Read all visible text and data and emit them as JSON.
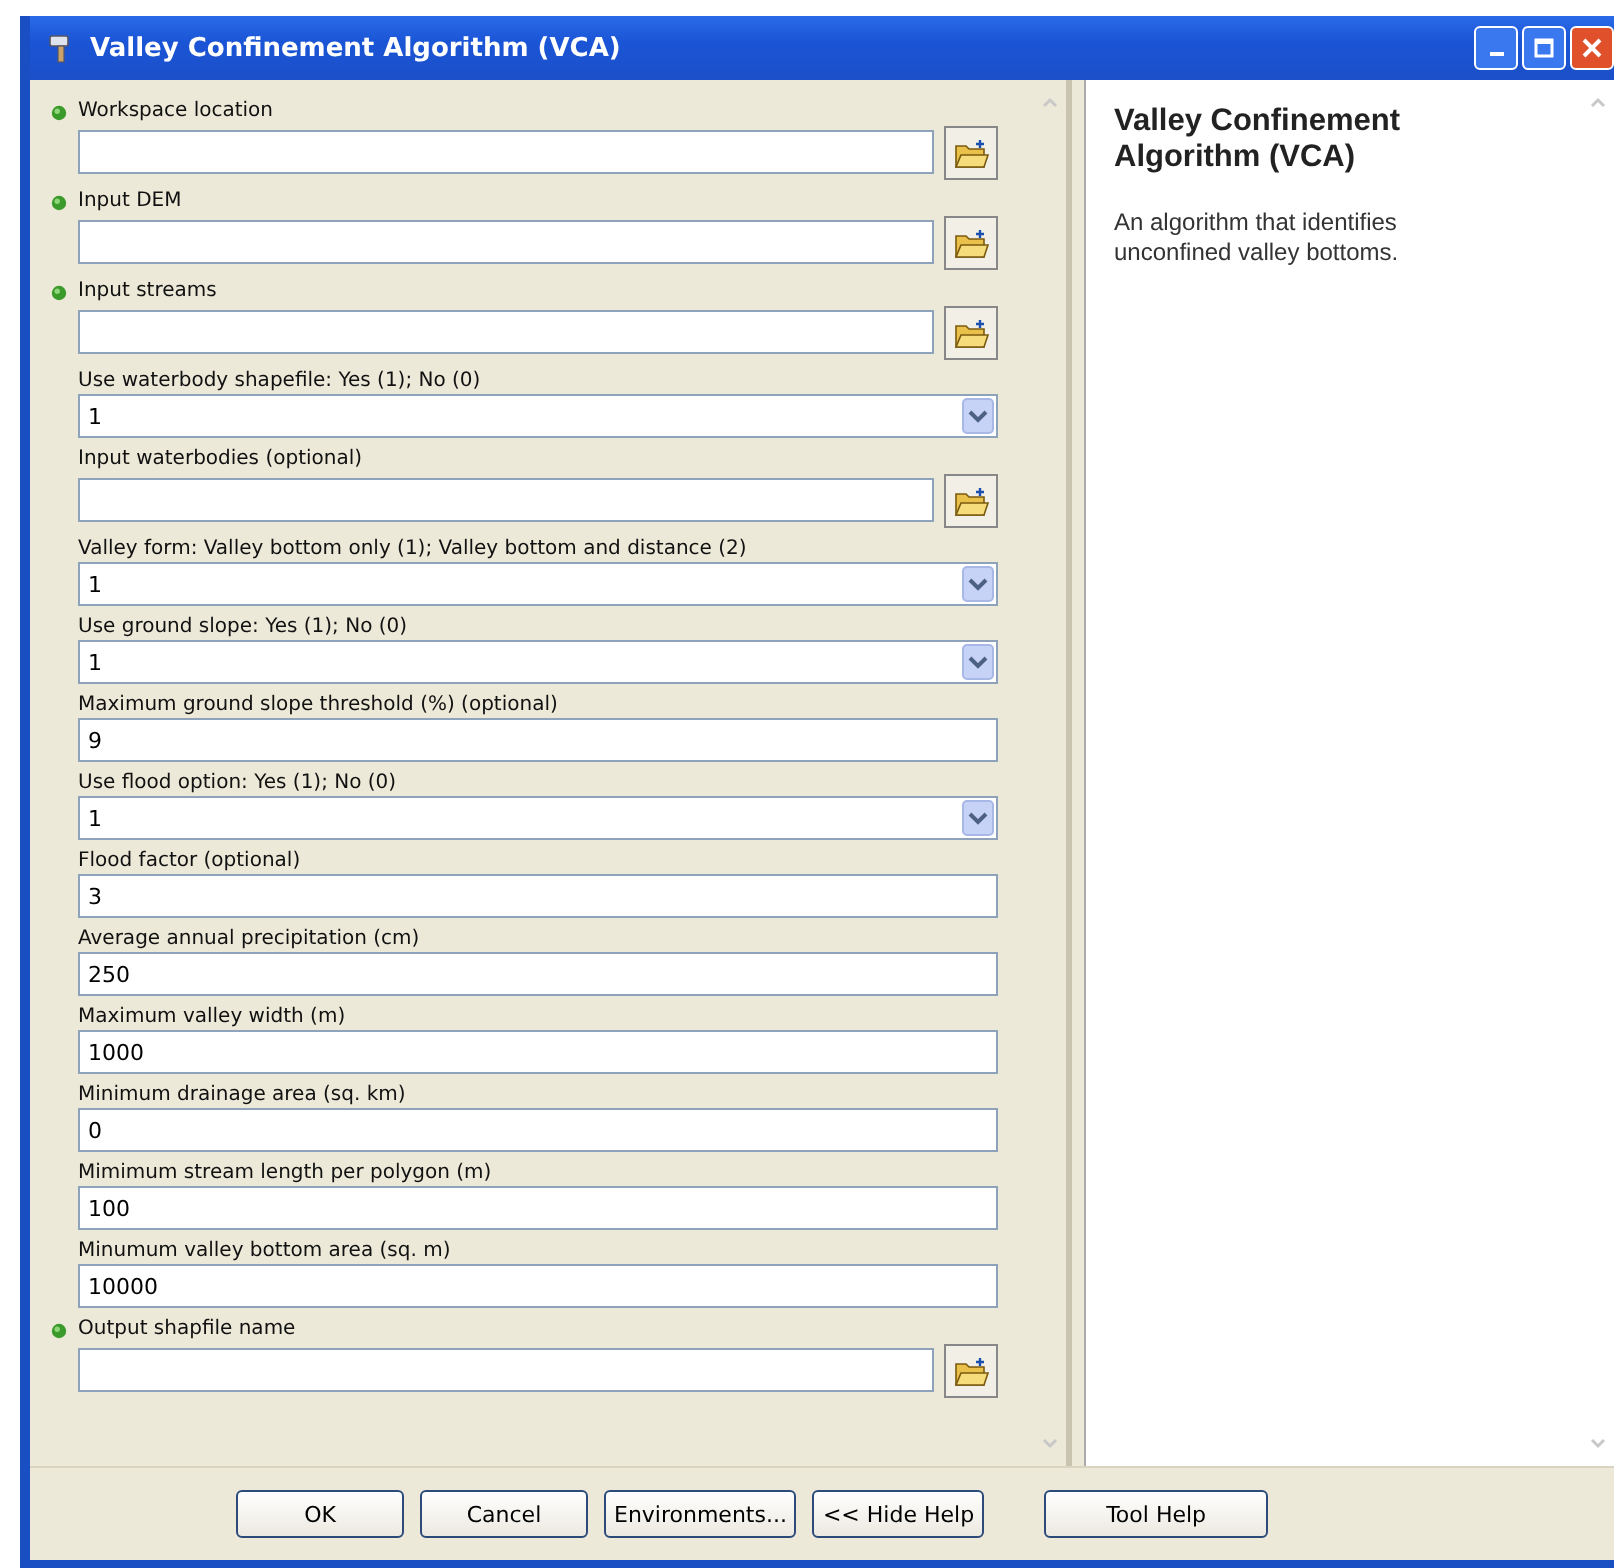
{
  "window": {
    "title": "Valley Confinement Algorithm (VCA)"
  },
  "parameters": [
    {
      "label": "Workspace location",
      "kind": "file",
      "required": true
    },
    {
      "label": "Input DEM",
      "kind": "file",
      "required": true
    },
    {
      "label": "Input streams",
      "kind": "file",
      "required": true
    },
    {
      "label": "Use waterbody shapefile: Yes (1); No (0)",
      "kind": "dropdown",
      "required": false,
      "value": "1"
    },
    {
      "label": "Input waterbodies (optional)",
      "kind": "file",
      "required": false
    },
    {
      "label": "Valley form: Valley bottom only (1); Valley bottom and distance (2)",
      "kind": "dropdown",
      "required": false,
      "value": "1"
    },
    {
      "label": "Use ground slope: Yes (1); No (0)",
      "kind": "dropdown",
      "required": false,
      "value": "1"
    },
    {
      "label": "Maximum ground slope threshold (%) (optional)",
      "kind": "text",
      "required": false,
      "value": "9"
    },
    {
      "label": "Use flood option: Yes (1); No (0)",
      "kind": "dropdown",
      "required": false,
      "value": "1"
    },
    {
      "label": "Flood factor (optional)",
      "kind": "text",
      "required": false,
      "value": "3"
    },
    {
      "label": "Average annual precipitation (cm)",
      "kind": "text",
      "required": false,
      "value": "250"
    },
    {
      "label": "Maximum valley width (m)",
      "kind": "text",
      "required": false,
      "value": "1000"
    },
    {
      "label": "Minimum drainage area (sq. km)",
      "kind": "text",
      "required": false,
      "value": "0"
    },
    {
      "label": "Mimimum stream length per polygon (m)",
      "kind": "text",
      "required": false,
      "value": "100"
    },
    {
      "label": "Minumum valley bottom area (sq. m)",
      "kind": "text",
      "required": false,
      "value": "10000"
    },
    {
      "label": "Output shapfile name",
      "kind": "file",
      "required": true
    }
  ],
  "help": {
    "title": "Valley Confinement Algorithm (VCA)",
    "description": "An algorithm that identifies unconfined valley bottoms."
  },
  "buttons": [
    "OK",
    "Cancel",
    "Environments...",
    "<< Hide Help"
  ],
  "help_button": "Tool Help"
}
